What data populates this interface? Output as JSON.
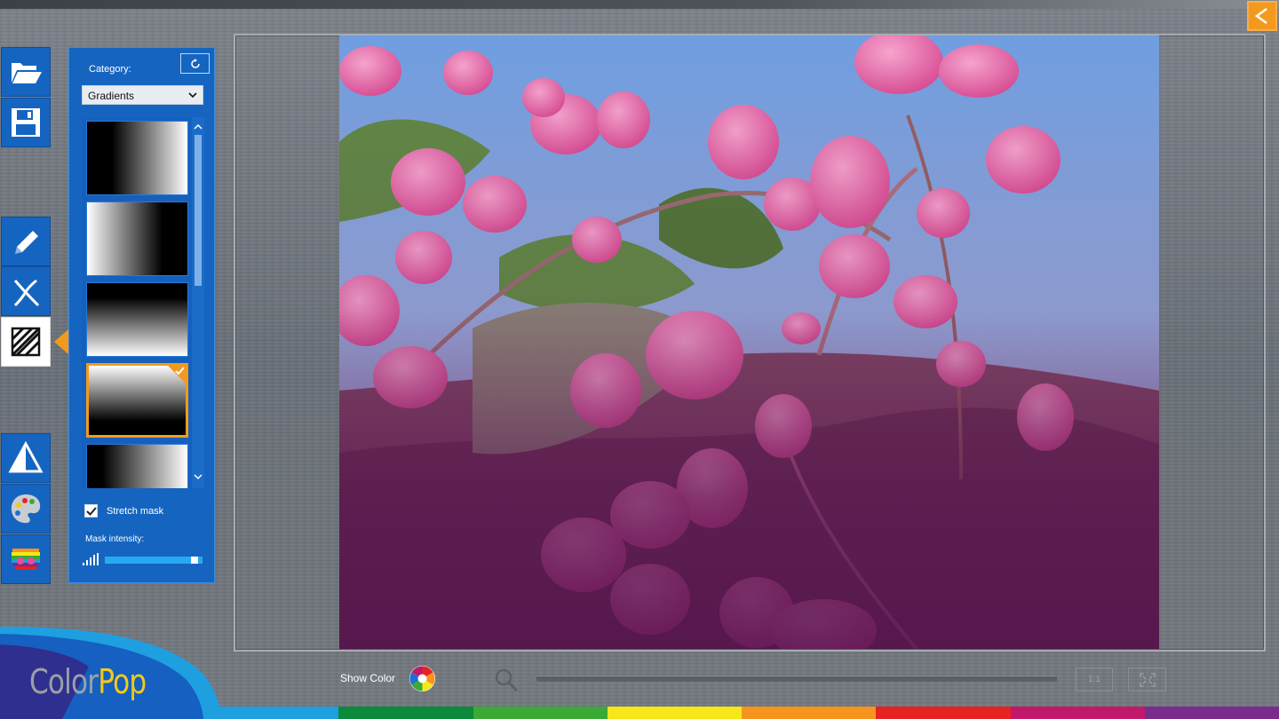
{
  "header": {
    "back_icon": "chevron-left-icon"
  },
  "toolbar": {
    "tools": [
      {
        "name": "open-icon"
      },
      {
        "name": "save-icon"
      },
      {
        "name": "pencil-icon"
      },
      {
        "name": "eraser-icon"
      },
      {
        "name": "gradient-mask-icon"
      },
      {
        "name": "triangle-icon"
      },
      {
        "name": "palette-icon"
      },
      {
        "name": "color-filter-icon"
      }
    ],
    "active_tool": "gradient-mask-icon"
  },
  "panel": {
    "category_label": "Category:",
    "category_selected": "Gradients",
    "thumbnails": [
      {
        "gradient": "horizontal-black-to-white"
      },
      {
        "gradient": "horizontal-white-to-black"
      },
      {
        "gradient": "vertical-black-to-white"
      },
      {
        "gradient": "vertical-white-to-black",
        "selected": true
      },
      {
        "gradient": "diagonal-black-to-white"
      }
    ],
    "stretch_mask_label": "Stretch mask",
    "stretch_mask_checked": true,
    "mask_intensity_label": "Mask intensity:",
    "mask_intensity": 0.95
  },
  "bottom_bar": {
    "show_color_label": "Show Color",
    "fit_label": "1:1"
  },
  "logo": {
    "part1": "Color",
    "part2": "Pop"
  },
  "colors": {
    "accent": "#f39a1e",
    "panel_blue": "#1565c0",
    "rainbow": [
      "#1e6fd0",
      "#0a8a3a",
      "#3aaa35",
      "#f6e71b",
      "#f7941d",
      "#e62222",
      "#c2186b",
      "#7a2c8c"
    ]
  }
}
